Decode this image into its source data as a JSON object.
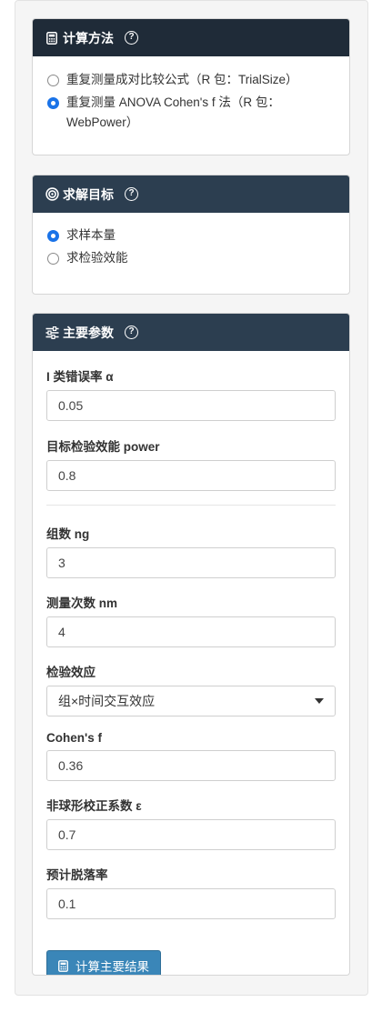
{
  "method_panel": {
    "title": "计算方法",
    "title_icon": "calculator-icon",
    "options": [
      {
        "label": "重复测量成对比较公式（R 包：TrialSize）",
        "checked": false
      },
      {
        "label": "重复测量 ANOVA Cohen's f 法（R 包：WebPower）",
        "checked": true
      }
    ]
  },
  "goal_panel": {
    "title": "求解目标",
    "title_icon": "target-icon",
    "options": [
      {
        "label": "求样本量",
        "checked": true
      },
      {
        "label": "求检验效能",
        "checked": false
      }
    ]
  },
  "params_panel": {
    "title": "主要参数",
    "title_icon": "sliders-icon",
    "alpha_label": "I 类错误率 α",
    "alpha_value": "0.05",
    "power_label": "目标检验效能 power",
    "power_value": "0.8",
    "ng_label": "组数 ng",
    "ng_value": "3",
    "nm_label": "测量次数 nm",
    "nm_value": "4",
    "effect_label": "检验效应",
    "effect_value": "组×时间交互效应",
    "f_label": "Cohen's f",
    "f_value": "0.36",
    "eps_label": "非球形校正系数 ε",
    "eps_value": "0.7",
    "dropout_label": "预计脱落率",
    "dropout_value": "0.1",
    "calc_button": "计算主要结果"
  },
  "help_glyph": "?",
  "colors": {
    "header": "#2c3e50",
    "button": "#3a86b8",
    "radio": "#1a73e8"
  }
}
